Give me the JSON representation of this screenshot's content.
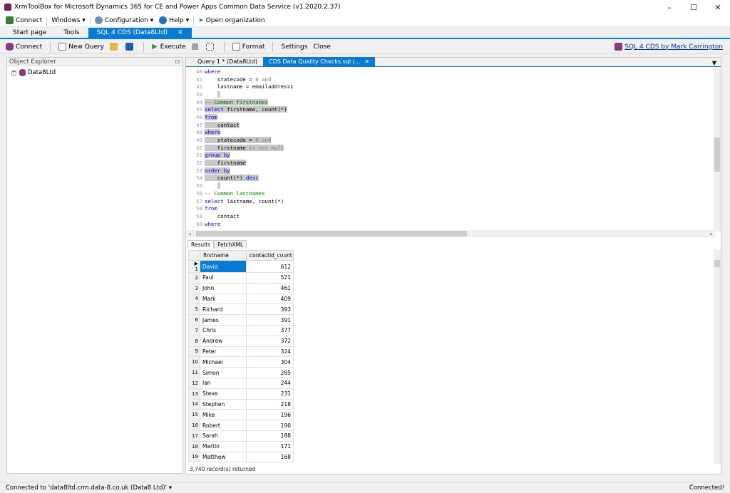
{
  "window": {
    "title": "XrmToolBox for Microsoft Dynamics 365 for CE and Power Apps Common Data Service (v1.2020.2.37)"
  },
  "menubar": {
    "connect": "Connect",
    "windows": "Windows",
    "configuration": "Configuration",
    "help": "Help",
    "open_organization": "Open organization"
  },
  "tabs": {
    "start_page": "Start page",
    "tools": "Tools",
    "active": "SQL 4 CDS (Data8Ltd)"
  },
  "toolbar": {
    "connect": "Connect",
    "new_query": "New Query",
    "execute": "Execute",
    "format": "Format",
    "settings": "Settings",
    "close": "Close",
    "credit_link": "SQL 4 CDS by Mark Carrington"
  },
  "object_explorer": {
    "title": "Object Explorer",
    "root": "Data8Ltd"
  },
  "doc_tabs": [
    {
      "label": "Query 1 * (Data8Ltd)"
    },
    {
      "label": "CDS Data Quality Checks.sql (..."
    }
  ],
  "code_lines": [
    {
      "n": "40",
      "segs": [
        {
          "t": "where",
          "c": "kw"
        }
      ]
    },
    {
      "n": "41",
      "segs": [
        {
          "t": "    statecode = ",
          "c": ""
        },
        {
          "t": "0",
          "c": "gr"
        },
        {
          "t": " and",
          "c": "gr"
        }
      ]
    },
    {
      "n": "42",
      "segs": [
        {
          "t": "    lastname = emailaddress1",
          "c": ""
        }
      ]
    },
    {
      "n": "43",
      "segs": [
        {
          "t": "    ",
          "c": ""
        },
        {
          "t": " ",
          "c": "sel"
        }
      ]
    },
    {
      "n": "44",
      "segs": [
        {
          "t": "-- Common firstnames",
          "c": "cm sel"
        }
      ]
    },
    {
      "n": "45",
      "segs": [
        {
          "t": "select",
          "c": "kw sel"
        },
        {
          "t": " firstname, count(*)",
          "c": "sel"
        }
      ]
    },
    {
      "n": "46",
      "segs": [
        {
          "t": "from",
          "c": "kw sel"
        }
      ]
    },
    {
      "n": "47",
      "segs": [
        {
          "t": "    contact",
          "c": "sel"
        }
      ]
    },
    {
      "n": "48",
      "segs": [
        {
          "t": "where",
          "c": "kw sel"
        }
      ]
    },
    {
      "n": "49",
      "segs": [
        {
          "t": "    statecode = ",
          "c": "sel"
        },
        {
          "t": "0",
          "c": "gr sel"
        },
        {
          "t": " and",
          "c": "gr sel"
        }
      ]
    },
    {
      "n": "50",
      "segs": [
        {
          "t": "    firstname ",
          "c": "sel"
        },
        {
          "t": "is not null",
          "c": "gr sel"
        }
      ]
    },
    {
      "n": "51",
      "segs": [
        {
          "t": "group by",
          "c": "kw sel"
        }
      ]
    },
    {
      "n": "52",
      "segs": [
        {
          "t": "    firstname",
          "c": "sel"
        }
      ]
    },
    {
      "n": "53",
      "segs": [
        {
          "t": "order by",
          "c": "kw sel"
        }
      ]
    },
    {
      "n": "54",
      "segs": [
        {
          "t": "    count(*) ",
          "c": "sel"
        },
        {
          "t": "desc",
          "c": "kw sel"
        }
      ]
    },
    {
      "n": "55",
      "segs": [
        {
          "t": "    ",
          "c": ""
        },
        {
          "t": " ",
          "c": "sel"
        }
      ]
    },
    {
      "n": "56",
      "segs": [
        {
          "t": "-- Common lastnames",
          "c": "cm"
        }
      ]
    },
    {
      "n": "57",
      "segs": [
        {
          "t": "select",
          "c": "kw"
        },
        {
          "t": " lastname, count(*)",
          "c": ""
        }
      ]
    },
    {
      "n": "58",
      "segs": [
        {
          "t": "from",
          "c": "kw"
        }
      ]
    },
    {
      "n": "59",
      "segs": [
        {
          "t": "    contact",
          "c": ""
        }
      ]
    },
    {
      "n": "60",
      "segs": [
        {
          "t": "where",
          "c": "kw"
        }
      ]
    }
  ],
  "results": {
    "tabs": [
      "Results",
      "FetchXML"
    ],
    "columns": [
      "firstname",
      "contactid_count"
    ],
    "rows": [
      [
        "David",
        "612"
      ],
      [
        "Paul",
        "521"
      ],
      [
        "John",
        "461"
      ],
      [
        "Mark",
        "409"
      ],
      [
        "Richard",
        "393"
      ],
      [
        "James",
        "391"
      ],
      [
        "Chris",
        "377"
      ],
      [
        "Andrew",
        "372"
      ],
      [
        "Peter",
        "324"
      ],
      [
        "Michael",
        "304"
      ],
      [
        "Simon",
        "285"
      ],
      [
        "Ian",
        "244"
      ],
      [
        "Steve",
        "231"
      ],
      [
        "Stephen",
        "218"
      ],
      [
        "Mike",
        "196"
      ],
      [
        "Robert",
        "190"
      ],
      [
        "Sarah",
        "188"
      ],
      [
        "Martin",
        "171"
      ],
      [
        "Matthew",
        "168"
      ]
    ],
    "record_count": "3,740 record(s) returned"
  },
  "status": {
    "connection": "Connected to 'data8ltd.crm.data-8.co.uk (Data8 Ltd)'",
    "state": "Connected!"
  }
}
